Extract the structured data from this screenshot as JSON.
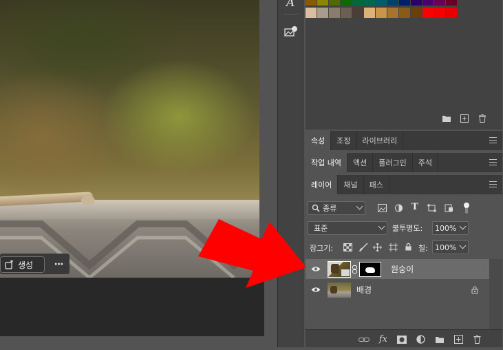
{
  "canvas": {
    "generate_label": "생성",
    "more_label": "···"
  },
  "toolbar_strip": {
    "icons": [
      "character-icon",
      "adjustments-icon"
    ]
  },
  "swatches": {
    "row1": [
      "#8a5a00",
      "#8a8600",
      "#4f6a00",
      "#0e6a00",
      "#006a3a",
      "#00684f",
      "#005d6a",
      "#00426a",
      "#00206a",
      "#2a006a",
      "#4a006a",
      "#6a0056",
      "#6a0026"
    ],
    "row2": [
      "#d9bfa0",
      "#a89d8a",
      "#8a7d6c",
      "#6b5e52",
      "#4a3f38",
      "#dbb27a",
      "#c9954a",
      "#a8732c",
      "#8a5a18",
      "#6b3f0a",
      "#ff0000",
      "#f40000",
      "#e80000"
    ],
    "footer_icons": [
      "folder-icon",
      "new-swatch-icon",
      "trash-icon"
    ]
  },
  "panel_tabs": {
    "group1": [
      "속성",
      "조정",
      "라이브러리"
    ],
    "group2": [
      "작업 내역",
      "액션",
      "플러그인",
      "주석"
    ],
    "group3": [
      "레이어",
      "채널",
      "패스"
    ]
  },
  "layers": {
    "filter_kind": "종류",
    "blend_mode": "표준",
    "opacity_label": "불투명도:",
    "opacity_value": "100%",
    "lock_label": "잠그기:",
    "fill_label": "칠:",
    "fill_value": "100%",
    "items": [
      {
        "name": "원숭이",
        "selected": true,
        "has_mask": true,
        "locked": false
      },
      {
        "name": "배경",
        "selected": false,
        "has_mask": false,
        "locked": true
      }
    ],
    "footer_icons": [
      "link-icon",
      "fx-icon",
      "mask-icon",
      "adjustment-layer-icon",
      "group-icon",
      "new-layer-icon",
      "trash-icon"
    ],
    "footer_fx_label": "fx"
  },
  "colors": {
    "panel_bg": "#535353",
    "tab_bg": "#3a3a3a",
    "selected_layer": "#6b6b6b",
    "arrow": "#ff0000"
  }
}
